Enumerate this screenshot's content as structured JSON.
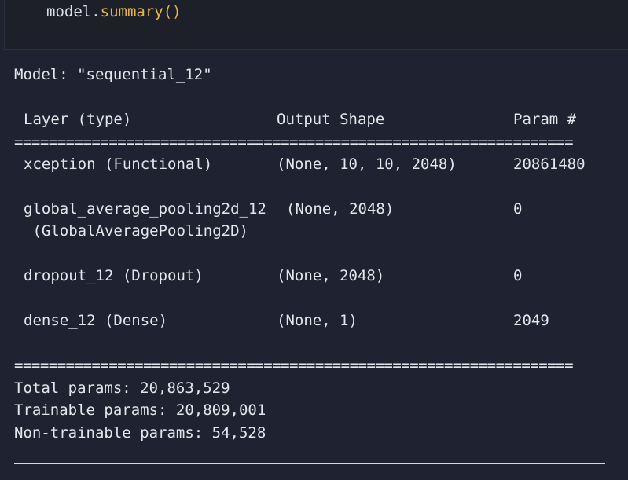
{
  "code_cell": {
    "object": "model",
    "dot": ".",
    "method": "summary",
    "parens": "()"
  },
  "output": {
    "model_title": "Model: \"sequential_12\"",
    "columns": [
      "Layer (type)",
      "Output Shape",
      "Param #"
    ],
    "rows": [
      {
        "layer": "xception (Functional)",
        "layer_cont": "",
        "shape": "(None, 10, 10, 2048)",
        "params": "20861480"
      },
      {
        "layer": "global_average_pooling2d_12",
        "layer_cont": " (GlobalAveragePooling2D)",
        "shape": "(None, 2048)",
        "params": "0"
      },
      {
        "layer": "dropout_12 (Dropout)",
        "layer_cont": "",
        "shape": "(None, 2048)",
        "params": "0"
      },
      {
        "layer": "dense_12 (Dense)",
        "layer_cont": "",
        "shape": "(None, 1)",
        "params": "2049"
      }
    ],
    "separator": "=================================================================",
    "total_params": "Total params: 20,863,529",
    "trainable_params": "Trainable params: 20,809,001",
    "non_trainable_params": "Non-trainable params: 54,528"
  },
  "colors": {
    "background": "#1f2230",
    "text": "#e3e6ec",
    "function_token": "#e5b64b"
  }
}
